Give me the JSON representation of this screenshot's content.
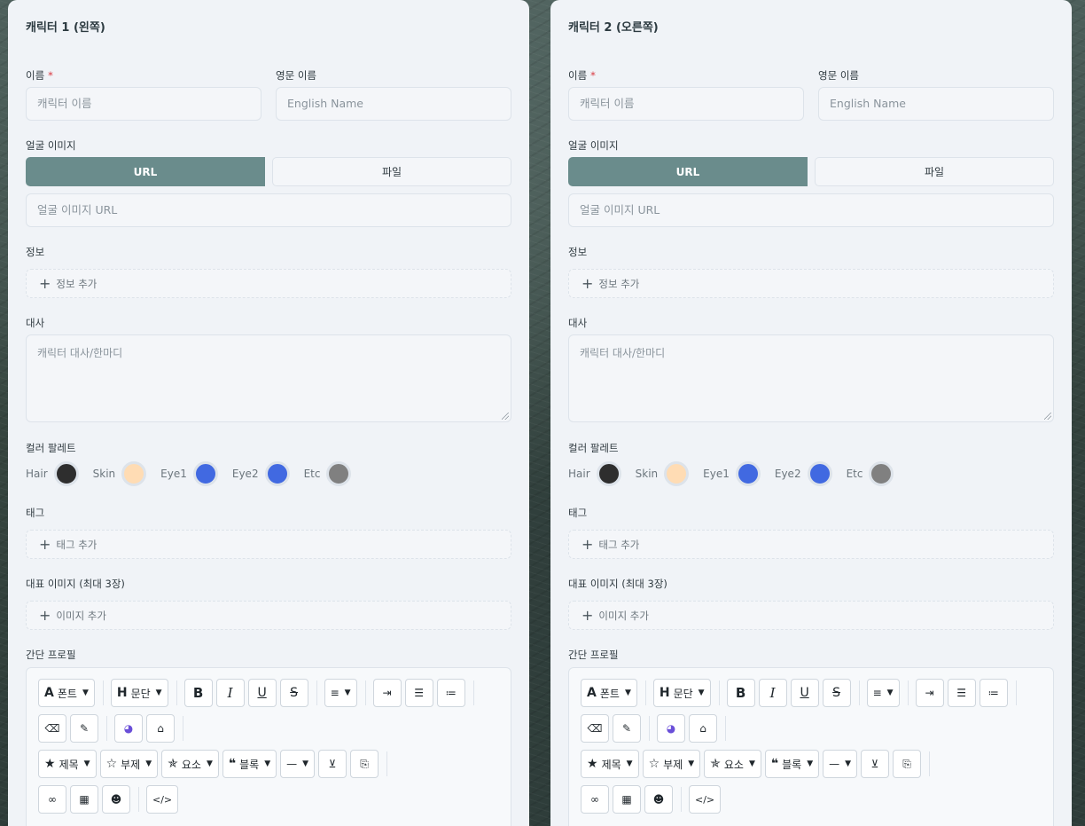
{
  "panels": [
    {
      "title": "캐릭터 1 (왼쪽)",
      "name_label": "이름",
      "required_mark": "*",
      "name_placeholder": "캐릭터 이름",
      "english_name_label": "영문 이름",
      "english_name_placeholder": "English Name",
      "face_image_label": "얼굴 이미지",
      "tab_url": "URL",
      "tab_file": "파일",
      "face_url_placeholder": "얼굴 이미지 URL",
      "info_label": "정보",
      "info_add": "정보 추가",
      "line_label": "대사",
      "line_placeholder": "캐릭터 대사/한마디",
      "palette_label": "컬러 팔레트",
      "palette": [
        {
          "name": "Hair",
          "color": "#2e2e2e"
        },
        {
          "name": "Skin",
          "color": "#ffdcb4"
        },
        {
          "name": "Eye1",
          "color": "#4169e1"
        },
        {
          "name": "Eye2",
          "color": "#4169e1"
        },
        {
          "name": "Etc",
          "color": "#808080"
        }
      ],
      "tag_label": "태그",
      "tag_add": "태그 추가",
      "rep_image_label": "대표 이미지 (최대 3장)",
      "image_add": "이미지 추가",
      "profile_label": "간단 프로필"
    },
    {
      "title": "캐릭터 2 (오른쪽)",
      "name_label": "이름",
      "required_mark": "*",
      "name_placeholder": "캐릭터 이름",
      "english_name_label": "영문 이름",
      "english_name_placeholder": "English Name",
      "face_image_label": "얼굴 이미지",
      "tab_url": "URL",
      "tab_file": "파일",
      "face_url_placeholder": "얼굴 이미지 URL",
      "info_label": "정보",
      "info_add": "정보 추가",
      "line_label": "대사",
      "line_placeholder": "캐릭터 대사/한마디",
      "palette_label": "컬러 팔레트",
      "palette": [
        {
          "name": "Hair",
          "color": "#2e2e2e"
        },
        {
          "name": "Skin",
          "color": "#ffdcb4"
        },
        {
          "name": "Eye1",
          "color": "#4169e1"
        },
        {
          "name": "Eye2",
          "color": "#4169e1"
        },
        {
          "name": "Etc",
          "color": "#808080"
        }
      ],
      "tag_label": "태그",
      "tag_add": "태그 추가",
      "rep_image_label": "대표 이미지 (최대 3장)",
      "image_add": "이미지 추가",
      "profile_label": "간단 프로필"
    }
  ],
  "toolbar": {
    "font": "폰트",
    "paragraph": "문단",
    "title": "제목",
    "subtitle": "부제",
    "element": "요소",
    "block": "블록"
  },
  "colors": {
    "accent": "#6a8c8c",
    "required": "#d9363e",
    "panel_bg": "#f0f3f7"
  }
}
